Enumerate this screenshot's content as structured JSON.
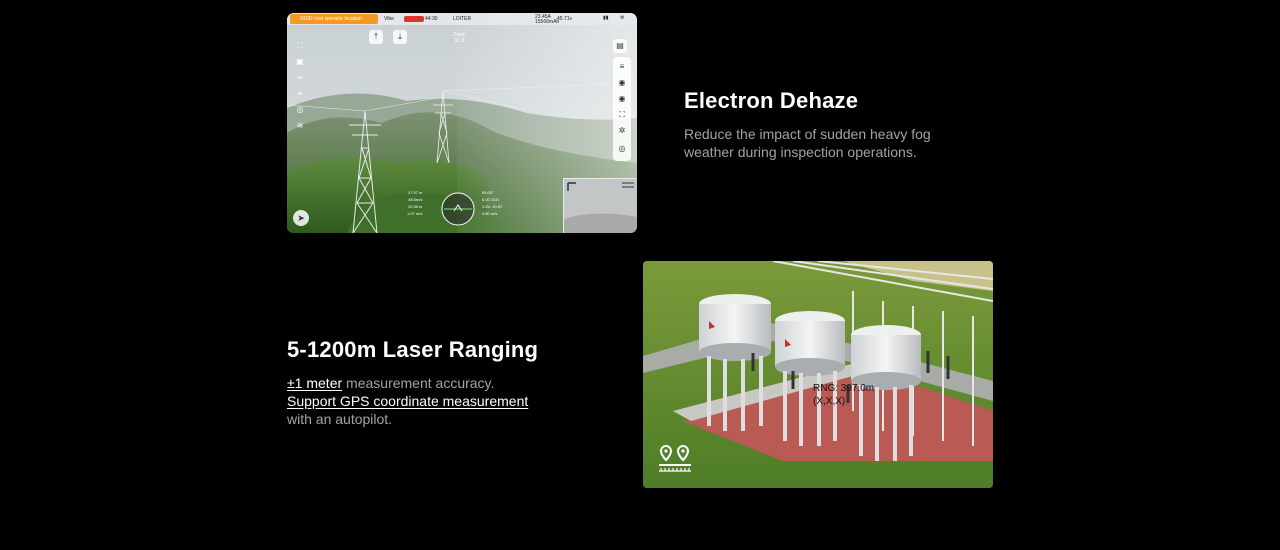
{
  "features": [
    {
      "title": "Electron Dehaze",
      "description_lines": [
        "Reduce the impact of sudden heavy fog",
        "weather during inspection operations."
      ],
      "screenshot": {
        "warning_text": "ODID: lost operator location",
        "vibe_label": "Vibe",
        "time_text": "44:30",
        "mode_text": "LOITER",
        "status_right": [
          "23.45A",
          "15566mAh",
          "45.71v"
        ],
        "zoom_label": "Zoom",
        "zoom_value": "91.3",
        "telemetry_left": [
          "17.97 m",
          "48.5m/s",
          "10.55 m",
          "1.07 m/s"
        ],
        "telemetry_right": [
          "55.00°",
          "0.00 OLD",
          "1.5V: 10.87",
          "3.80 m/s"
        ]
      }
    },
    {
      "title": "5-1200m Laser Ranging",
      "line1_highlight": "±1 meter",
      "line1_rest": " measurement accuracy.",
      "line2_highlight": "Support GPS coordinate measurement",
      "line3": "with an autopilot.",
      "screenshot": {
        "range_text": "RNG: 397.0m",
        "coord_text": "(X,X,X)"
      }
    }
  ]
}
